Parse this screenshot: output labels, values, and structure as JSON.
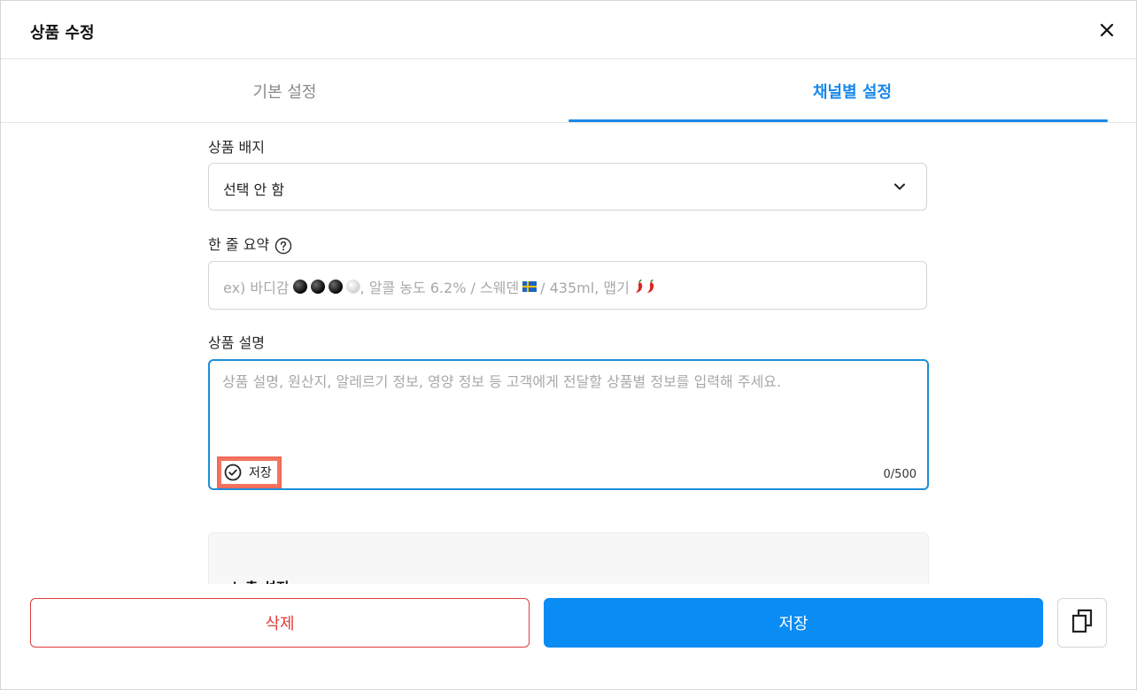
{
  "header": {
    "title": "상품 수정",
    "close_icon": "close-icon"
  },
  "tabs": [
    {
      "label": "기본 설정",
      "active": false
    },
    {
      "label": "채널별 설정",
      "active": true
    }
  ],
  "fields": {
    "badge": {
      "label": "상품 배지",
      "value": "선택 안 함",
      "icon": "chevron-down-icon"
    },
    "summary": {
      "label": "한 줄 요약",
      "help_icon": "help-circle-icon",
      "placeholder": {
        "prefix": "ex) 바디감",
        "body_level_dots": {
          "filled": 3,
          "total": 4
        },
        "alcohol": ", 알콜 농도 6.2% / 스웨덴",
        "flag": "sweden-flag-icon",
        "volume": "/ 435ml, 맵기",
        "spice_level": 2,
        "spice_icon": "chili-pepper-icon"
      }
    },
    "description": {
      "label": "상품 설명",
      "placeholder": "상품 설명, 원산지, 알레르기 정보, 영양 정보 등 고객에게 전달할 상품별 정보를 입력해 주세요.",
      "save_label": "저장",
      "save_icon": "check-circle-icon",
      "counter": "0/500"
    }
  },
  "panel": {
    "title": "노출 설정"
  },
  "footer": {
    "delete_label": "삭제",
    "save_label": "저장",
    "copy_icon": "copy-icon"
  },
  "colors": {
    "accent": "#1a88e8",
    "primary_button": "#0a8cf5",
    "danger": "#e23c3c",
    "highlight": "#f47560"
  }
}
